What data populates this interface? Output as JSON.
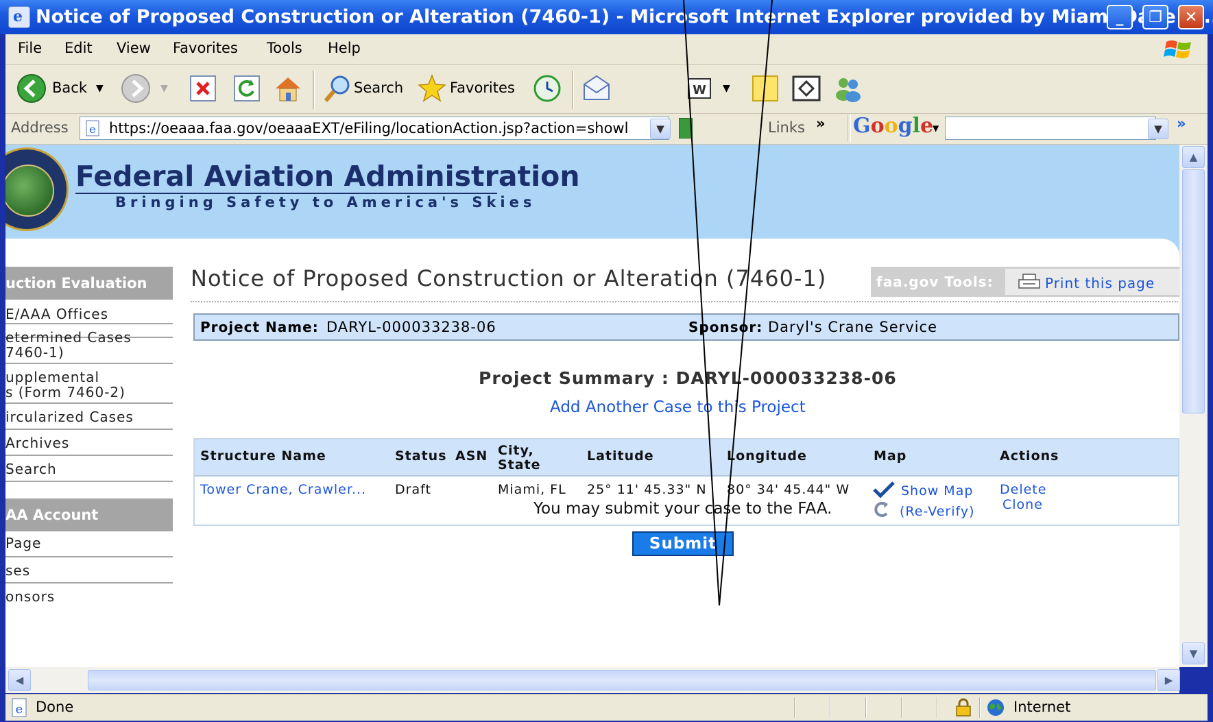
{
  "window": {
    "title": "Notice of Proposed Construction or Alteration (7460-1) - Microsoft Internet Explorer provided by Miami-Dade A...",
    "minimize": "_",
    "maximize": "❐",
    "close": "✕"
  },
  "menu": [
    "File",
    "Edit",
    "View",
    "Favorites",
    "Tools",
    "Help"
  ],
  "toolbar": {
    "back": "Back",
    "search": "Search",
    "favorites": "Favorites"
  },
  "addressbar": {
    "label": "Address",
    "url": "https://oeaaa.faa.gov/oeaaaEXT/eFiling/locationAction.jsp?action=showl",
    "links": "Links",
    "chevrons": "»",
    "google": "Google"
  },
  "faa": {
    "title": "Federal Aviation Administration",
    "tagline": "Bringing Safety to America's Skies"
  },
  "nav": {
    "header1": "uction Evaluation",
    "items1": [
      "E/AAA Offices",
      "etermined Cases\n7460-1)",
      "upplemental\ns (Form 7460-2)",
      "ircularized Cases",
      "Archives",
      "Search"
    ],
    "header2": "AA Account",
    "items2": [
      "Page",
      "ses",
      "onsors"
    ]
  },
  "page": {
    "title": "Notice of Proposed Construction or Alteration (7460-1)",
    "tools_label": "faa.gov Tools:",
    "print": "Print this page",
    "project_name_label": "Project Name:",
    "project_name": "DARYL-000033238-06",
    "sponsor_label": "Sponsor:",
    "sponsor": "Daryl's Crane Service",
    "summary_title": "Project Summary : DARYL-000033238-06",
    "add_case": "Add Another Case to this Project",
    "submit_msg": "You may submit your case to the FAA.",
    "submit": "Submit"
  },
  "table": {
    "headers": [
      "Structure Name",
      "Status",
      "ASN",
      "City,\nState",
      "Latitude",
      "Longitude",
      "Map",
      "Actions"
    ],
    "row": {
      "structure": "Tower Crane, Crawler...",
      "status": "Draft",
      "city": "Miami, FL",
      "latitude": "25° 11' 45.33\" N",
      "longitude": "80° 34' 45.44\" W",
      "show_map": "Show Map",
      "reverify": "(Re-Verify)",
      "delete": "Delete",
      "clone": "Clone"
    }
  },
  "status": {
    "done": "Done",
    "zone": "Internet"
  },
  "colors": {
    "faa_header_bg": "#add6f6",
    "link": "#1a55d8",
    "submit_bg": "#1a7ce8"
  }
}
